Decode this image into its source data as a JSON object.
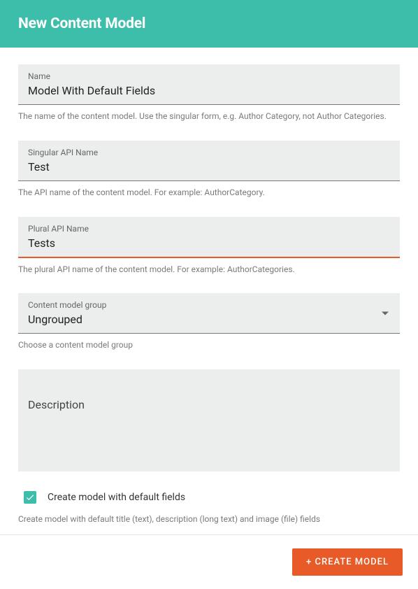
{
  "header": {
    "title": "New Content Model"
  },
  "fields": {
    "name": {
      "label": "Name",
      "value": "Model With Default Fields",
      "help": "The name of the content model. Use the singular form, e.g. Author Category, not Author Categories."
    },
    "singular": {
      "label": "Singular API Name",
      "value": "Test",
      "help": "The API name of the content model. For example: AuthorCategory."
    },
    "plural": {
      "label": "Plural API Name",
      "value": "Tests",
      "help": "The plural API name of the content model. For example: AuthorCategories."
    },
    "group": {
      "label": "Content model group",
      "value": "Ungrouped",
      "help": "Choose a content model group"
    },
    "description": {
      "label": "Description"
    },
    "defaultFields": {
      "label": "Create model with default fields",
      "help": "Create model with default title (text), description (long text) and image (file) fields"
    }
  },
  "footer": {
    "createButton": "+ CREATE MODEL"
  }
}
